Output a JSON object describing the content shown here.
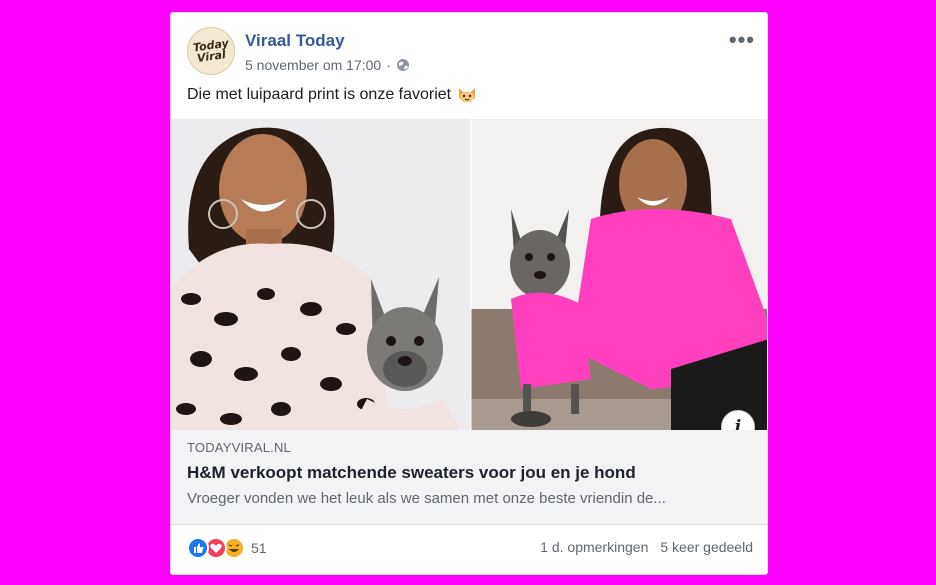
{
  "post": {
    "page_name": "Viraal Today",
    "avatar_text_line1": "Today",
    "avatar_text_line2": "Viral",
    "timestamp": "5 november om 17:00",
    "privacy_icon": "globe-icon",
    "more_label": "•••",
    "text": "Die met luipaard print is onze favoriet",
    "emoji": "cat-face-emoji"
  },
  "link": {
    "domain": "TODAYVIRAL.NL",
    "headline": "H&M verkoopt matchende sweaters voor jou en je hond",
    "description": "Vroeger vonden we het leuk als we samen met onze beste vriendin de..."
  },
  "footer": {
    "reaction_icons": [
      "like-icon",
      "love-icon",
      "haha-icon"
    ],
    "reaction_count": "51",
    "comments": "1 d. opmerkingen",
    "shares": "5 keer gedeeld"
  },
  "colors": {
    "background": "#ff00ff",
    "page_name": "#385898",
    "link_box": "#f2f3f5",
    "like": "#1877f2",
    "love": "#f33e58",
    "haha": "#f7b125",
    "pink_sweater": "#ff3fbd"
  }
}
